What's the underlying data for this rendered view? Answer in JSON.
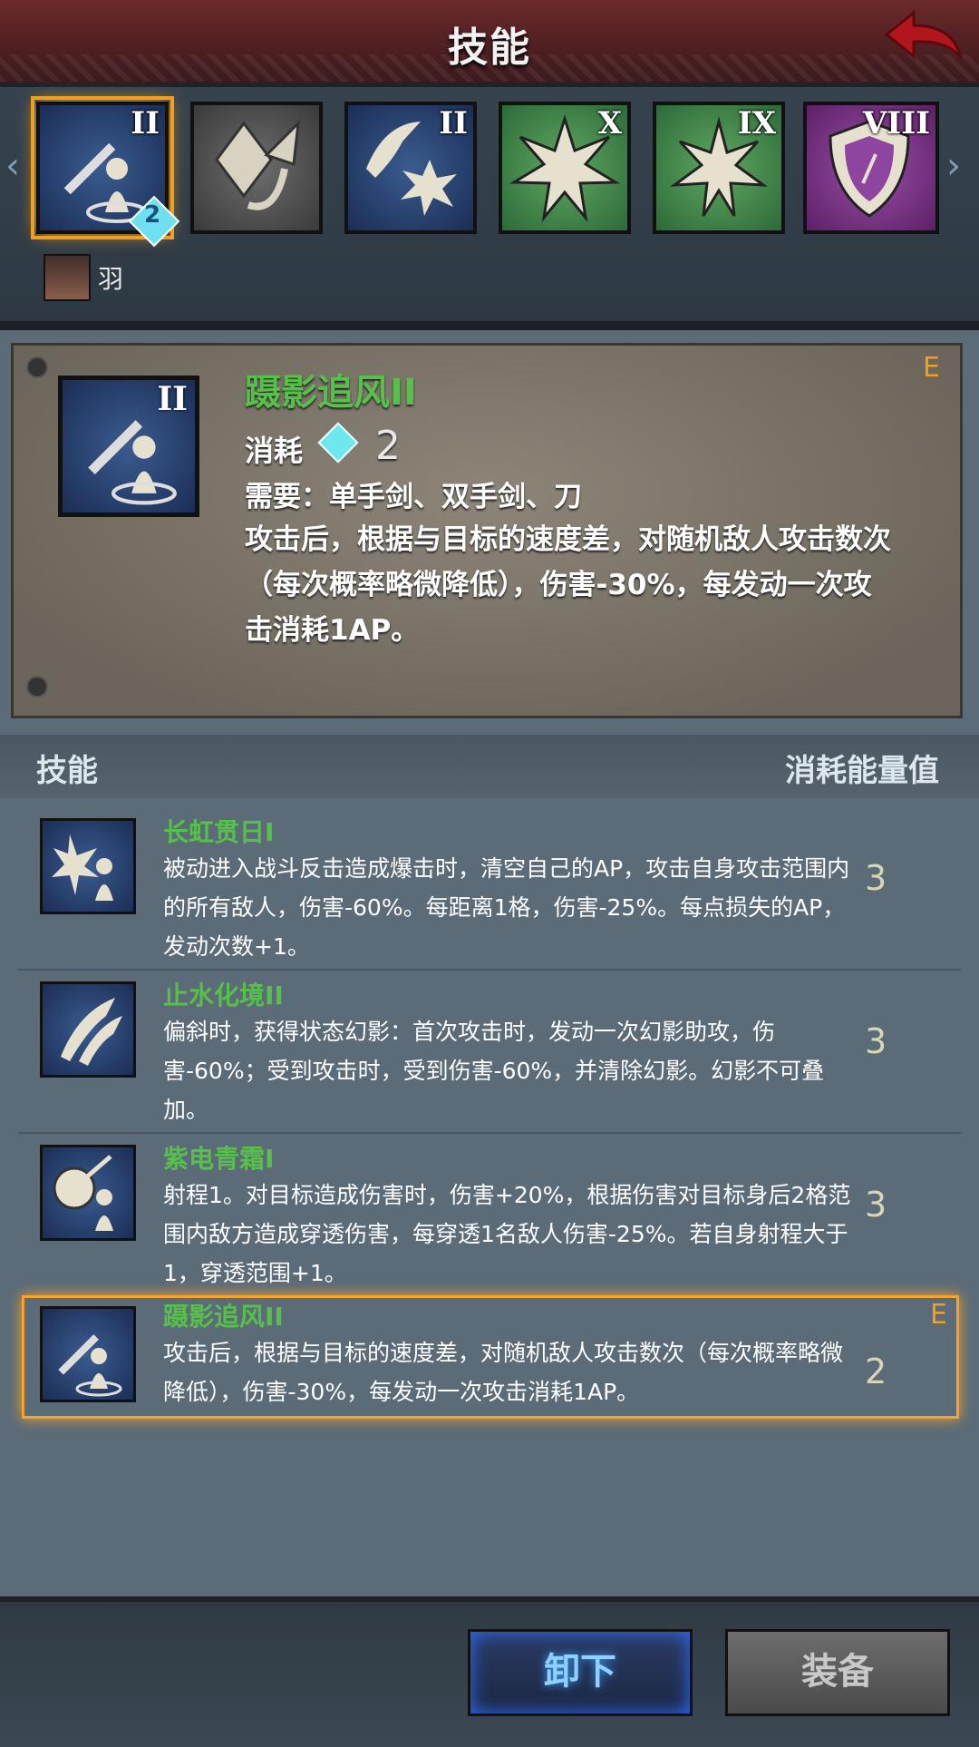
{
  "header": {
    "title": "技能"
  },
  "skill_strip": {
    "icons": [
      {
        "name": "skill-icon-1",
        "level": "II",
        "color": "blue",
        "selected": true
      },
      {
        "name": "skill-icon-2",
        "level": "",
        "color": "grey"
      },
      {
        "name": "skill-icon-3",
        "level": "II",
        "color": "blue"
      },
      {
        "name": "skill-icon-4",
        "level": "X",
        "color": "green"
      },
      {
        "name": "skill-icon-5",
        "level": "IX",
        "color": "green"
      },
      {
        "name": "skill-icon-6",
        "level": "VIII",
        "color": "purple"
      }
    ],
    "selected_badge": "2",
    "character_name": "羽"
  },
  "detail": {
    "level": "II",
    "name": "蹑影追风II",
    "tag": "E",
    "cost_label": "消耗",
    "cost_value": "2",
    "requirement": "需要：单手剑、双手剑、刀",
    "description": "攻击后，根据与目标的速度差，对随机敌人攻击数次（每次概率略微降低），伤害-30%，每发动一次攻击消耗1AP。"
  },
  "list_header": {
    "left": "技能",
    "right": "消耗能量值"
  },
  "skills": [
    {
      "name": "长虹贯日I",
      "desc": "被动进入战斗反击造成爆击时，清空自己的AP，攻击自身攻击范围内的所有敌人，伤害-60%。每距离1格，伤害-25%。每点损失的AP，发动次数+1。",
      "cost": "3"
    },
    {
      "name": "止水化境II",
      "desc": "偏斜时，获得状态幻影：首次攻击时，发动一次幻影助攻，伤害-60%；受到攻击时，受到伤害-60%，并清除幻影。幻影不可叠加。",
      "cost": "3"
    },
    {
      "name": "紫电青霜I",
      "desc": "射程1。对目标造成伤害时，伤害+20%，根据伤害对目标身后2格范围内敌方造成穿透伤害，每穿透1名敌人伤害-25%。若自身射程大于1，穿透范围+1。",
      "cost": "3"
    },
    {
      "name": "蹑影追风II",
      "desc": "攻击后，根据与目标的速度差，对随机敌人攻击数次（每次概率略微降低），伤害-30%，每发动一次攻击消耗1AP。",
      "cost": "2",
      "tag": "E"
    }
  ],
  "buttons": {
    "unequip": "卸下",
    "equip": "装备"
  }
}
